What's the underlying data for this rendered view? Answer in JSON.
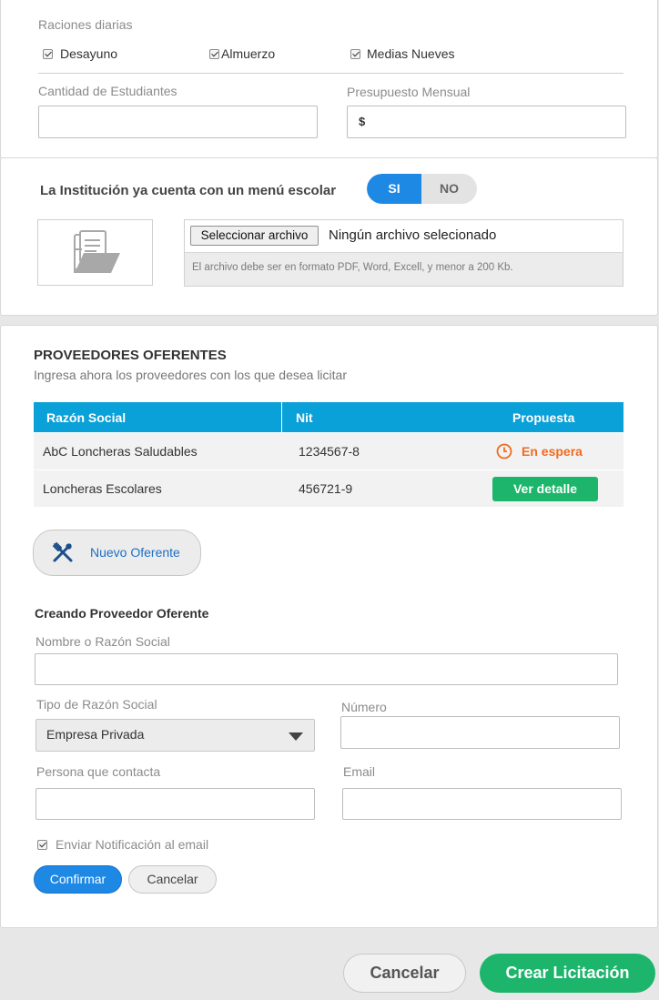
{
  "rations": {
    "label": "Raciones diarias",
    "options": [
      {
        "label": "Desayuno",
        "checked": true
      },
      {
        "label": "Almuerzo",
        "checked": true
      },
      {
        "label": "Medias Nueves",
        "checked": true
      }
    ]
  },
  "students": {
    "label": "Cantidad de Estudiantes",
    "value": ""
  },
  "budget": {
    "label": "Presupuesto Mensual",
    "value": "$"
  },
  "menu": {
    "question": "La Institución ya cuenta con un menú escolar",
    "yes": "SI",
    "no": "NO",
    "selected": "SI",
    "file_button": "Seleccionar archivo",
    "file_status": "Ningún archivo selecionado",
    "file_hint": "El archivo debe ser en formato PDF, Word, Excell, y menor a 200 Kb.",
    "icon": "file-folder-icon"
  },
  "providers": {
    "title": "PROVEEDORES OFERENTES",
    "subtitle": "Ingresa ahora los proveedores con los que desea licitar",
    "columns": [
      "Razón Social",
      "Nit",
      "Propuesta"
    ],
    "rows": [
      {
        "name": "AbC Loncheras Saludables",
        "nit": "1234567-8",
        "status": "En espera",
        "status_color": "#f26b21"
      },
      {
        "name": "Loncheras Escolares",
        "nit": "456721-9",
        "action": "Ver detalle"
      }
    ],
    "new_button": "Nuevo Oferente"
  },
  "form": {
    "title": "Creando Proveedor Oferente",
    "name_label": "Nombre o Razón Social",
    "name_value": "",
    "type_label": "Tipo de Razón Social",
    "type_value": "Empresa Privada",
    "number_label": "Número",
    "number_value": "",
    "contact_label": "Persona que contacta",
    "contact_value": "",
    "email_label": "Email",
    "email_value": "",
    "notify_label": "Enviar Notificación al email",
    "notify_checked": true,
    "confirm": "Confirmar",
    "cancel": "Cancelar"
  },
  "footer": {
    "cancel": "Cancelar",
    "create": "Crear Licitación"
  },
  "colors": {
    "accent": "#1e88e5",
    "table_header": "#0aa0d8",
    "success": "#1cb56b",
    "warning": "#f26b21"
  }
}
